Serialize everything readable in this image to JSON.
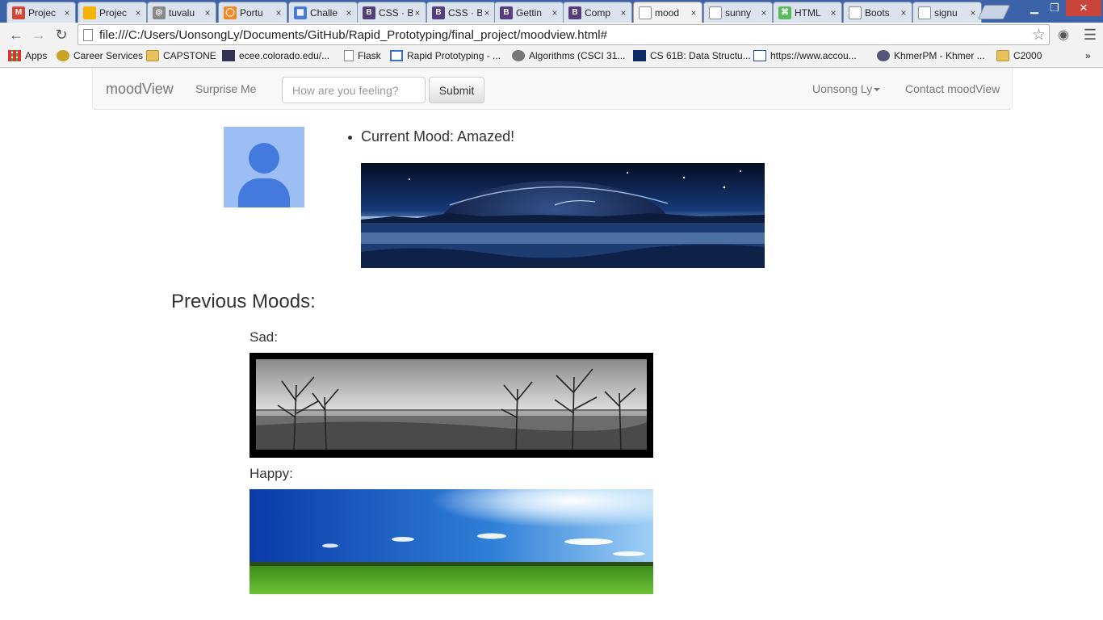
{
  "browser": {
    "tabs": [
      {
        "label": "Projec",
        "icon": "gmail-icon",
        "color": "#d44638",
        "glyph": "M"
      },
      {
        "label": "Projec",
        "icon": "slides-icon",
        "color": "#f4b400",
        "glyph": ""
      },
      {
        "label": "tuvalu",
        "icon": "github-icon",
        "color": "#888888",
        "glyph": "◎"
      },
      {
        "label": "Portu",
        "icon": "portfolio-icon",
        "color": "#f08a24",
        "glyph": "◯"
      },
      {
        "label": "Challe",
        "icon": "calendar-icon",
        "color": "#4a7bd0",
        "glyph": "▦"
      },
      {
        "label": "CSS · B",
        "icon": "bootstrap-icon",
        "color": "#563d7c",
        "glyph": "B"
      },
      {
        "label": "CSS · B",
        "icon": "bootstrap-icon",
        "color": "#563d7c",
        "glyph": "B"
      },
      {
        "label": "Gettin",
        "icon": "bootstrap-icon",
        "color": "#563d7c",
        "glyph": "B"
      },
      {
        "label": "Comp",
        "icon": "bootstrap-icon",
        "color": "#563d7c",
        "glyph": "B"
      },
      {
        "label": "mood",
        "icon": "page-icon",
        "color": "#ffffff",
        "glyph": "",
        "active": true
      },
      {
        "label": "sunny",
        "icon": "page-icon",
        "color": "#ffffff",
        "glyph": ""
      },
      {
        "label": "HTML",
        "icon": "html-icon",
        "color": "#5cb85c",
        "glyph": "⌘"
      },
      {
        "label": "Boots",
        "icon": "page-icon",
        "color": "#ffffff",
        "glyph": ""
      },
      {
        "label": "signu",
        "icon": "page-icon",
        "color": "#ffffff",
        "glyph": ""
      }
    ],
    "url": "file:///C:/Users/UonsongLy/Documents/GitHub/Rapid_Prototyping/final_project/moodview.html#",
    "bookmarks": [
      {
        "label": "Apps",
        "type": "apps"
      },
      {
        "label": "Career Services",
        "type": "cu"
      },
      {
        "label": "CAPSTONE",
        "type": "folder"
      },
      {
        "label": "ecee.colorado.edu/...",
        "type": "img"
      },
      {
        "label": "Flask",
        "type": "page"
      },
      {
        "label": "Rapid Prototyping - ...",
        "type": "cal"
      },
      {
        "label": "Algorithms (CSCI 31...",
        "type": "gear"
      },
      {
        "label": "CS 61B: Data Structu...",
        "type": "eecs"
      },
      {
        "label": "https://www.accou...",
        "type": "citi"
      },
      {
        "label": "KhmerPM - Khmer ...",
        "type": "khmer"
      },
      {
        "label": "C2000",
        "type": "folder"
      }
    ]
  },
  "navbar": {
    "brand": "moodView",
    "surprise": "Surprise Me",
    "search_placeholder": "How are you feeling?",
    "submit": "Submit",
    "user": "Uonsong Ly",
    "contact": "Contact moodView"
  },
  "profile": {
    "current_mood": "Current Mood: Amazed!"
  },
  "previous": {
    "title": "Previous Moods:",
    "items": [
      {
        "label": "Sad:"
      },
      {
        "label": "Happy:"
      }
    ]
  }
}
